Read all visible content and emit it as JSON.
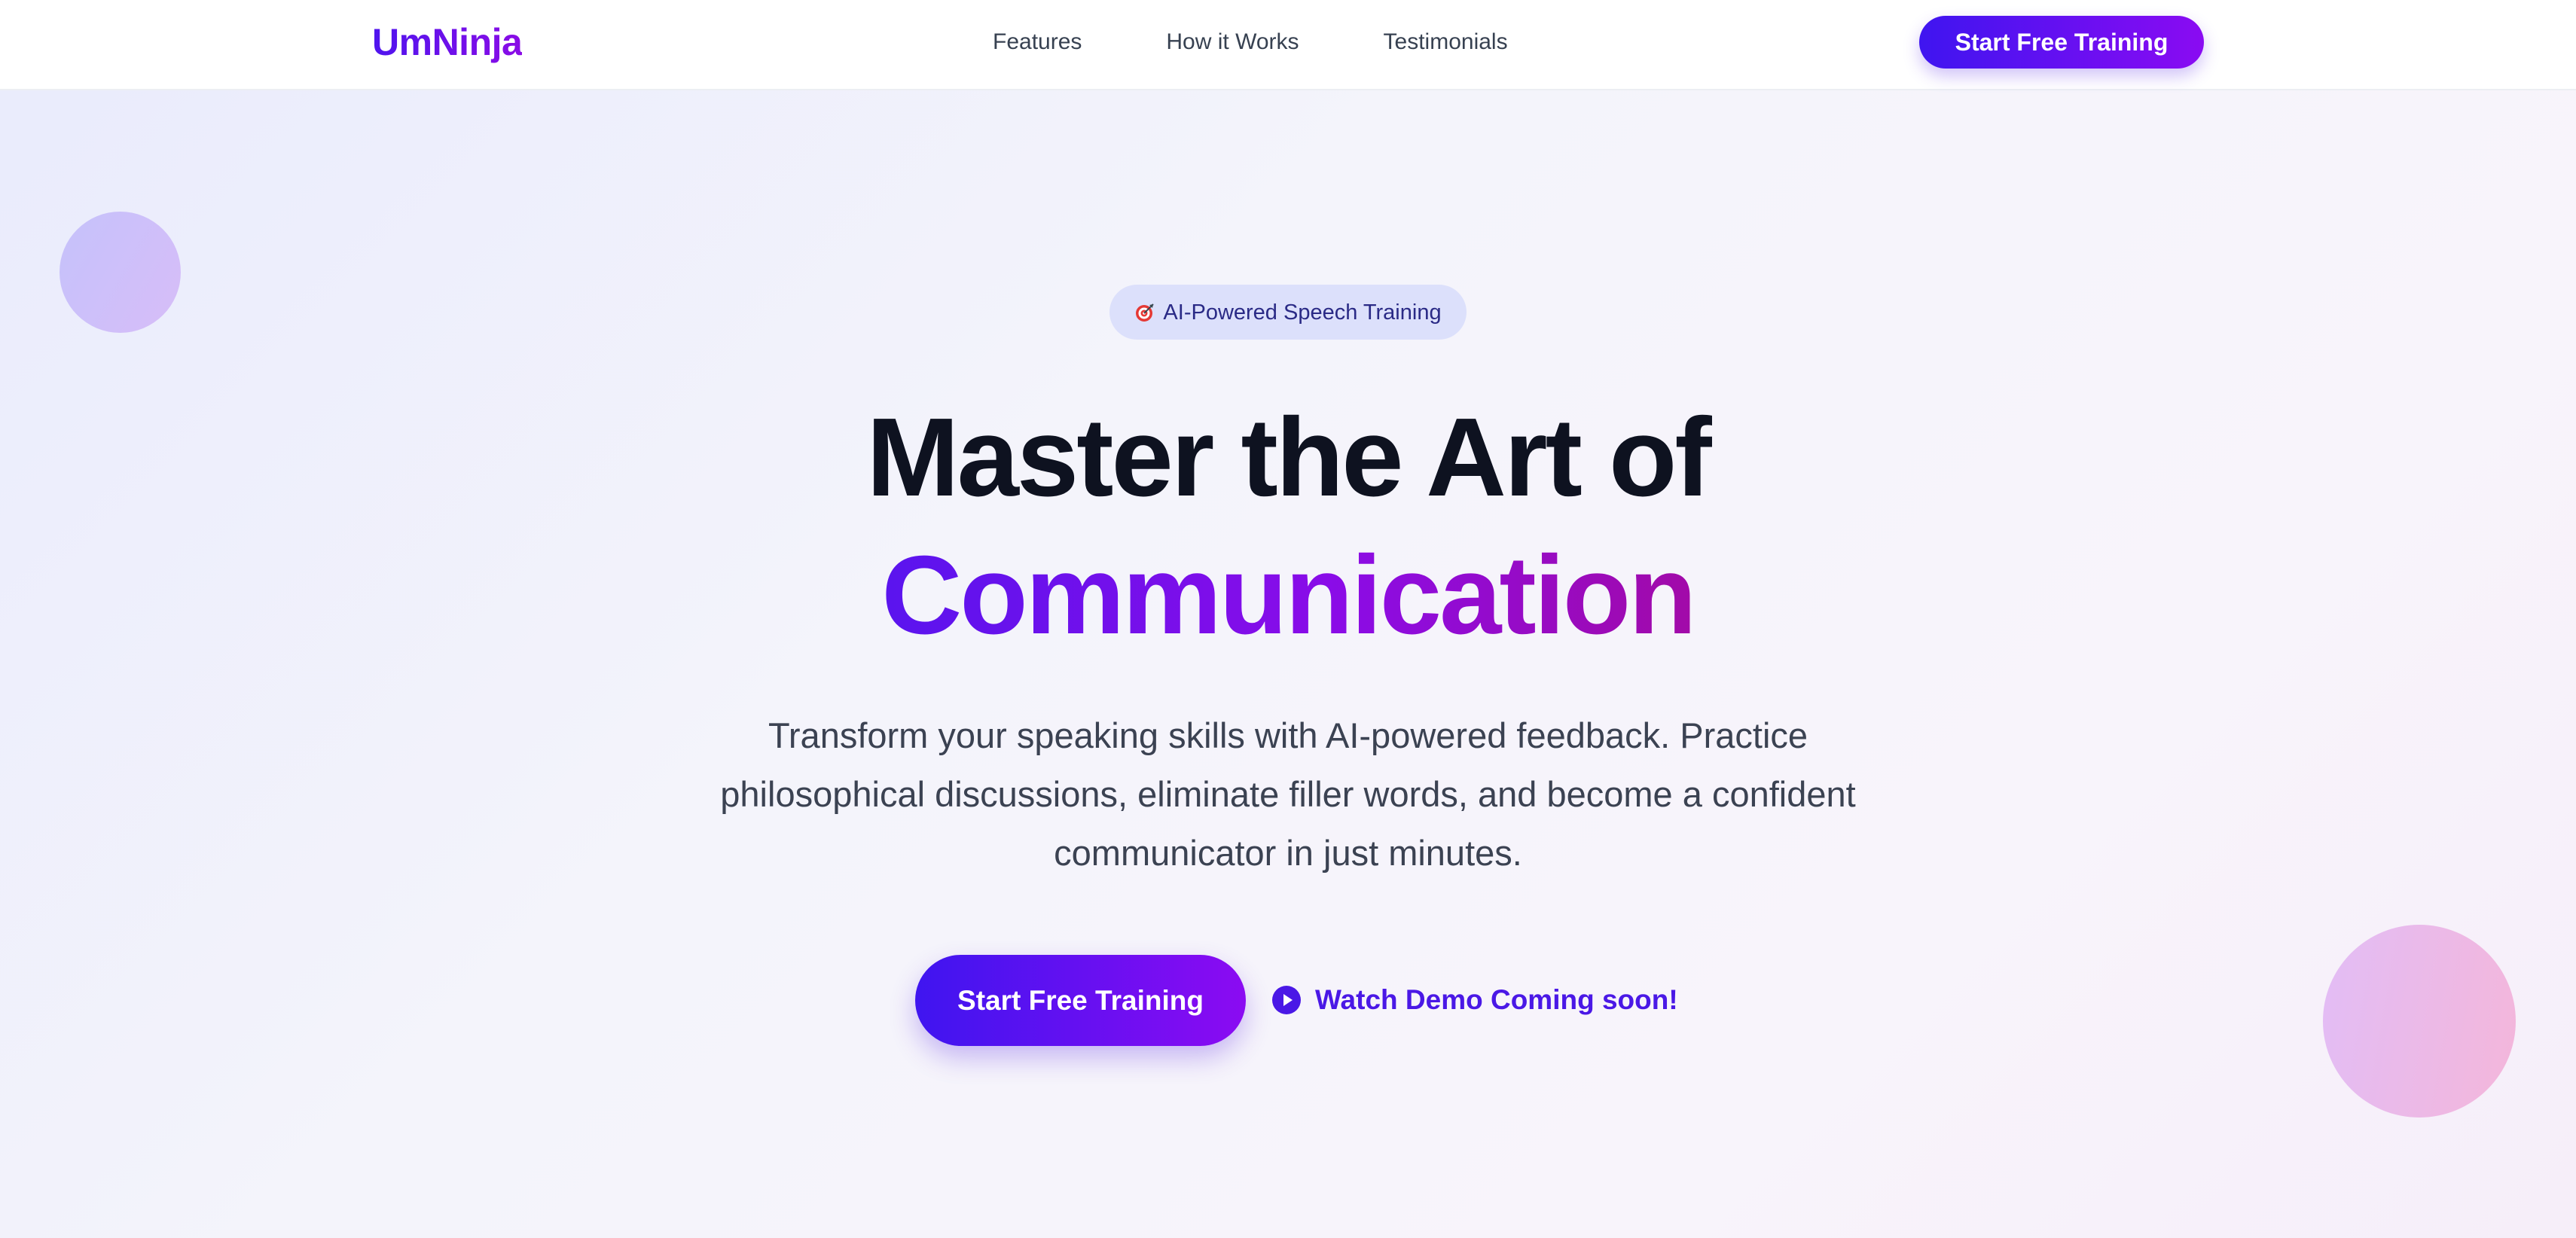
{
  "brand": {
    "logo_text": "UmNinja"
  },
  "nav": {
    "links": [
      {
        "label": "Features"
      },
      {
        "label": "How it Works"
      },
      {
        "label": "Testimonials"
      }
    ],
    "cta_label": "Start Free Training"
  },
  "hero": {
    "badge": {
      "icon": "target-icon",
      "text": "AI-Powered Speech Training"
    },
    "headline_line1": "Master the Art of",
    "headline_line2": "Communication",
    "subtitle": "Transform your speaking skills with AI-powered feedback. Practice philosophical discussions, eliminate filler words, and become a confident communicator in just minutes.",
    "primary_cta_label": "Start Free Training",
    "secondary_cta": {
      "icon": "play-circle-icon",
      "label": "Watch Demo Coming soon!"
    }
  },
  "colors": {
    "brand_gradient_start": "#3f15f0",
    "brand_gradient_end": "#8b0bf2",
    "headline_dark": "#0e1220",
    "badge_bg": "#dce0fb",
    "accent_link": "#4a18e6"
  }
}
